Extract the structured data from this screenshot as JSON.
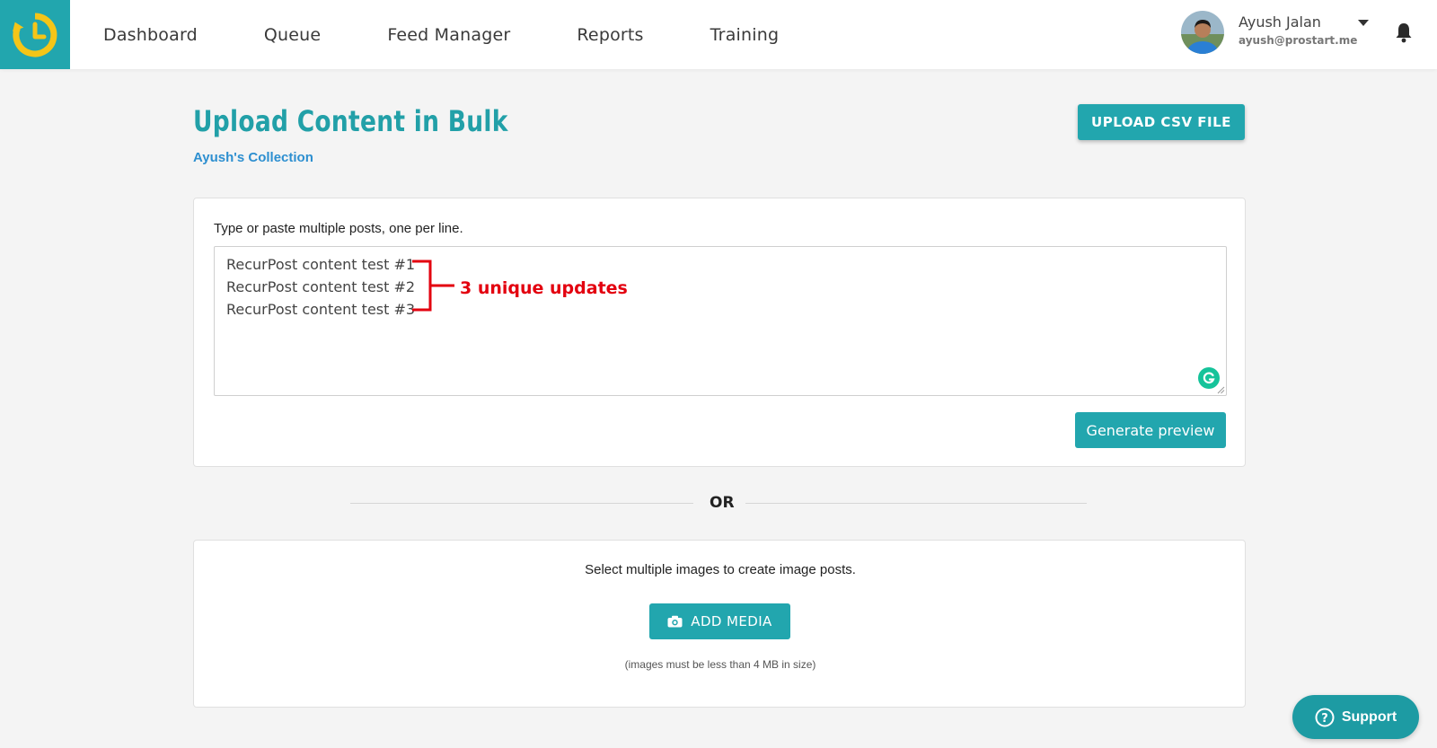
{
  "nav": {
    "items": [
      "Dashboard",
      "Queue",
      "Feed Manager",
      "Reports",
      "Training"
    ]
  },
  "user": {
    "name": "Ayush Jalan",
    "email": "ayush@prostart.me"
  },
  "page": {
    "title": "Upload Content in Bulk",
    "collection": "Ayush's Collection",
    "upload_csv_label": "UPLOAD CSV FILE"
  },
  "text_card": {
    "instruction": "Type or paste multiple posts, one per line.",
    "posts": [
      "RecurPost content test #1",
      "RecurPost content test #2",
      "RecurPost content test #3"
    ],
    "annotation": "3 unique updates",
    "generate_label": "Generate preview"
  },
  "divider": {
    "label": "OR"
  },
  "media_card": {
    "instruction": "Select multiple images to create image posts.",
    "add_media_label": "ADD MEDIA",
    "note": "(images must be less than 4 MB in size)"
  },
  "support": {
    "label": "Support"
  },
  "colors": {
    "accent": "#22a6ae",
    "title": "#22a0a8",
    "link": "#2d8fd0",
    "annotation": "#e3000f",
    "logo_clock": "#f5c518"
  },
  "icons": [
    "clock-logo-icon",
    "chevron-down-icon",
    "bell-icon",
    "grammarly-icon",
    "camera-icon",
    "question-icon"
  ]
}
